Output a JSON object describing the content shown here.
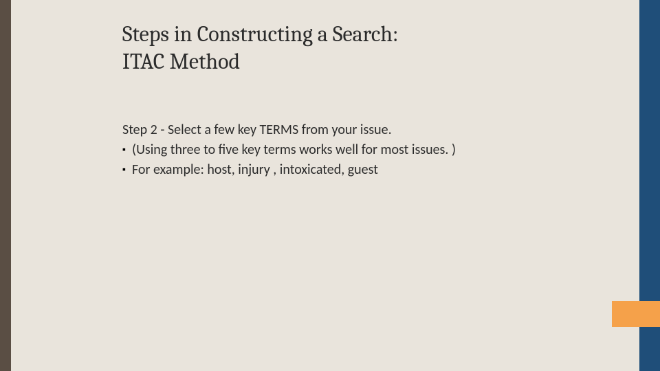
{
  "title_line1": "Steps in Constructing a Search:",
  "title_line2": "ITAC Method",
  "step_heading": "Step 2 - Select a few key TERMS from your issue.",
  "bullets": [
    "(Using three to five key terms works well for most issues. )",
    "For example: host, injury , intoxicated, guest"
  ],
  "colors": {
    "background": "#e9e4dc",
    "left_stripe": "#5a4e44",
    "right_stripe": "#1f4e79",
    "orange_tab": "#f5a14a"
  }
}
